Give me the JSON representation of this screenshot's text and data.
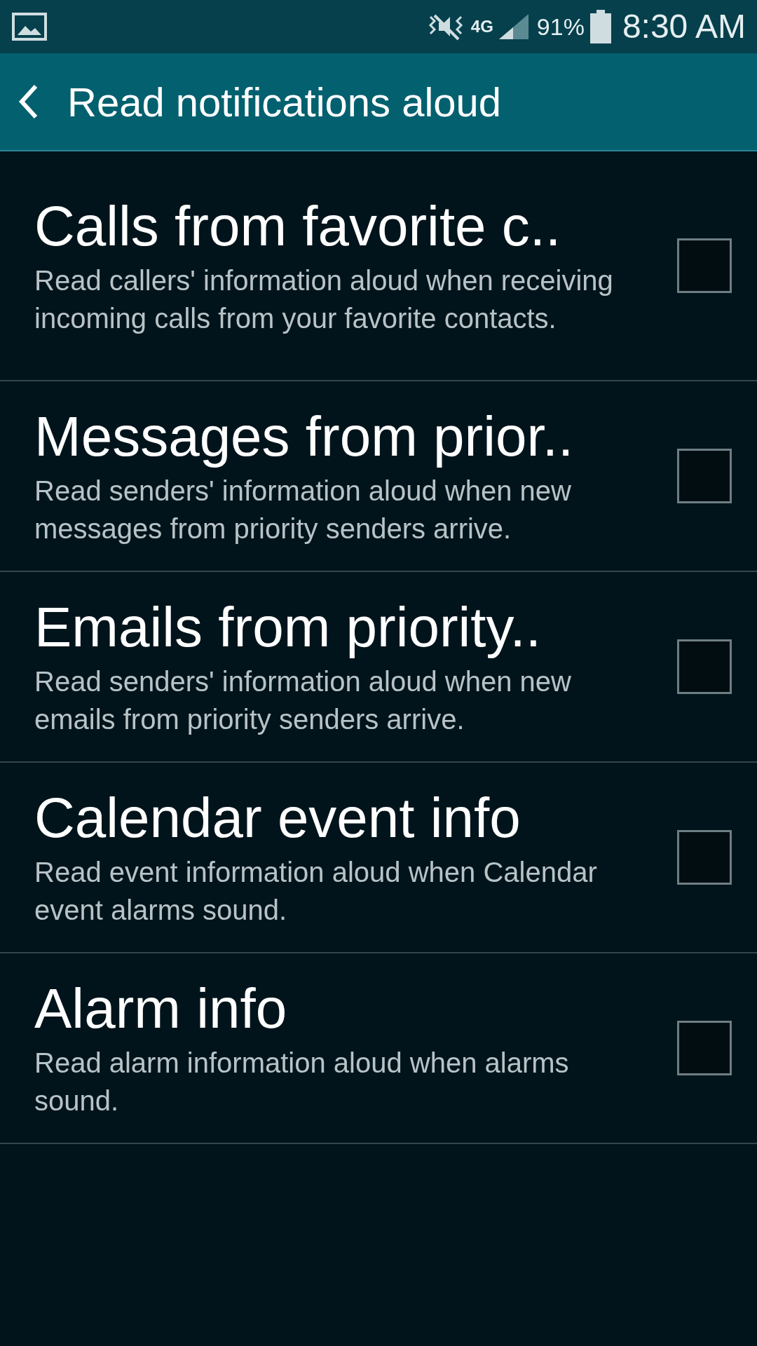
{
  "status_bar": {
    "network": "4G",
    "battery": "91%",
    "time": "8:30 AM"
  },
  "header": {
    "title": "Read notifications aloud"
  },
  "items": [
    {
      "title": "Calls from favorite c..",
      "description": "Read callers' information aloud when receiving incoming calls from your favorite contacts.",
      "checked": false
    },
    {
      "title": "Messages from prior..",
      "description": "Read senders' information aloud when new messages from priority senders arrive.",
      "checked": false
    },
    {
      "title": "Emails from priority..",
      "description": "Read senders' information aloud when new emails from priority senders arrive.",
      "checked": false
    },
    {
      "title": "Calendar event info",
      "description": "Read event information aloud when Calendar event alarms sound.",
      "checked": false
    },
    {
      "title": "Alarm info",
      "description": "Read alarm information aloud when alarms sound.",
      "checked": false
    }
  ]
}
